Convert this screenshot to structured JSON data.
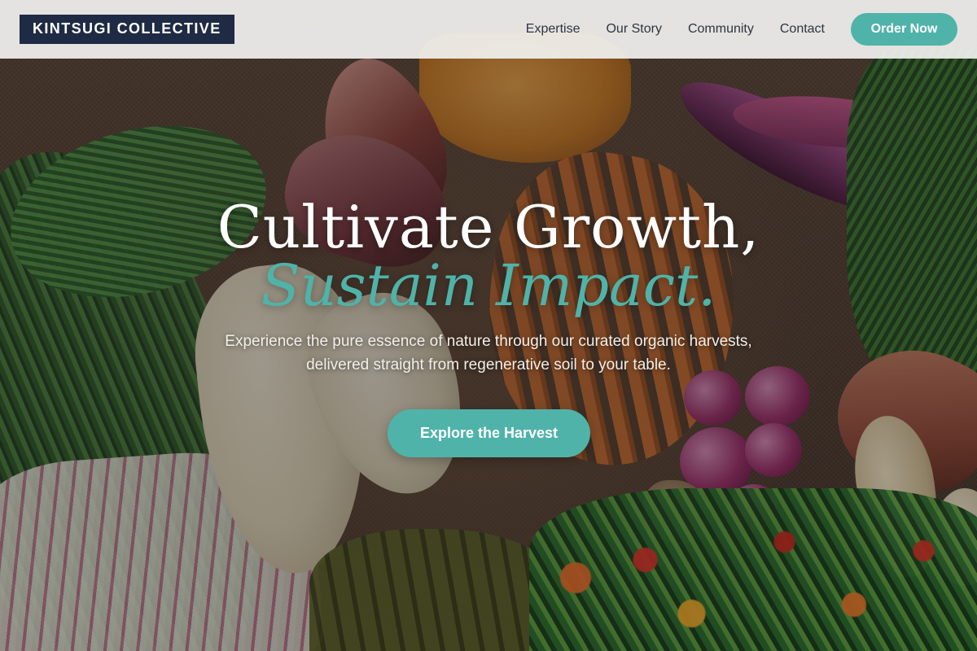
{
  "header": {
    "logo_text": "KINTSUGI COLLECTIVE",
    "nav_items": [
      {
        "label": "Expertise"
      },
      {
        "label": "Our Story"
      },
      {
        "label": "Community"
      },
      {
        "label": "Contact"
      }
    ],
    "cta_label": "Order Now"
  },
  "hero": {
    "headline_line_1": "Cultivate Growth,",
    "headline_line_2": "Sustain Impact.",
    "subtitle": "Experience the pure essence of nature through our curated organic harvests, delivered straight from regenerative soil to your table.",
    "cta_label": "Explore the Harvest",
    "background_description_icon": "produce-photo-background"
  },
  "colors": {
    "accent": "#4fb3a9",
    "logo_background": "#1f2a44",
    "header_background": "#f2f2f0",
    "nav_text": "#2f3440",
    "headline_text": "#ffffff",
    "subtitle_text": "#f2efe9"
  }
}
